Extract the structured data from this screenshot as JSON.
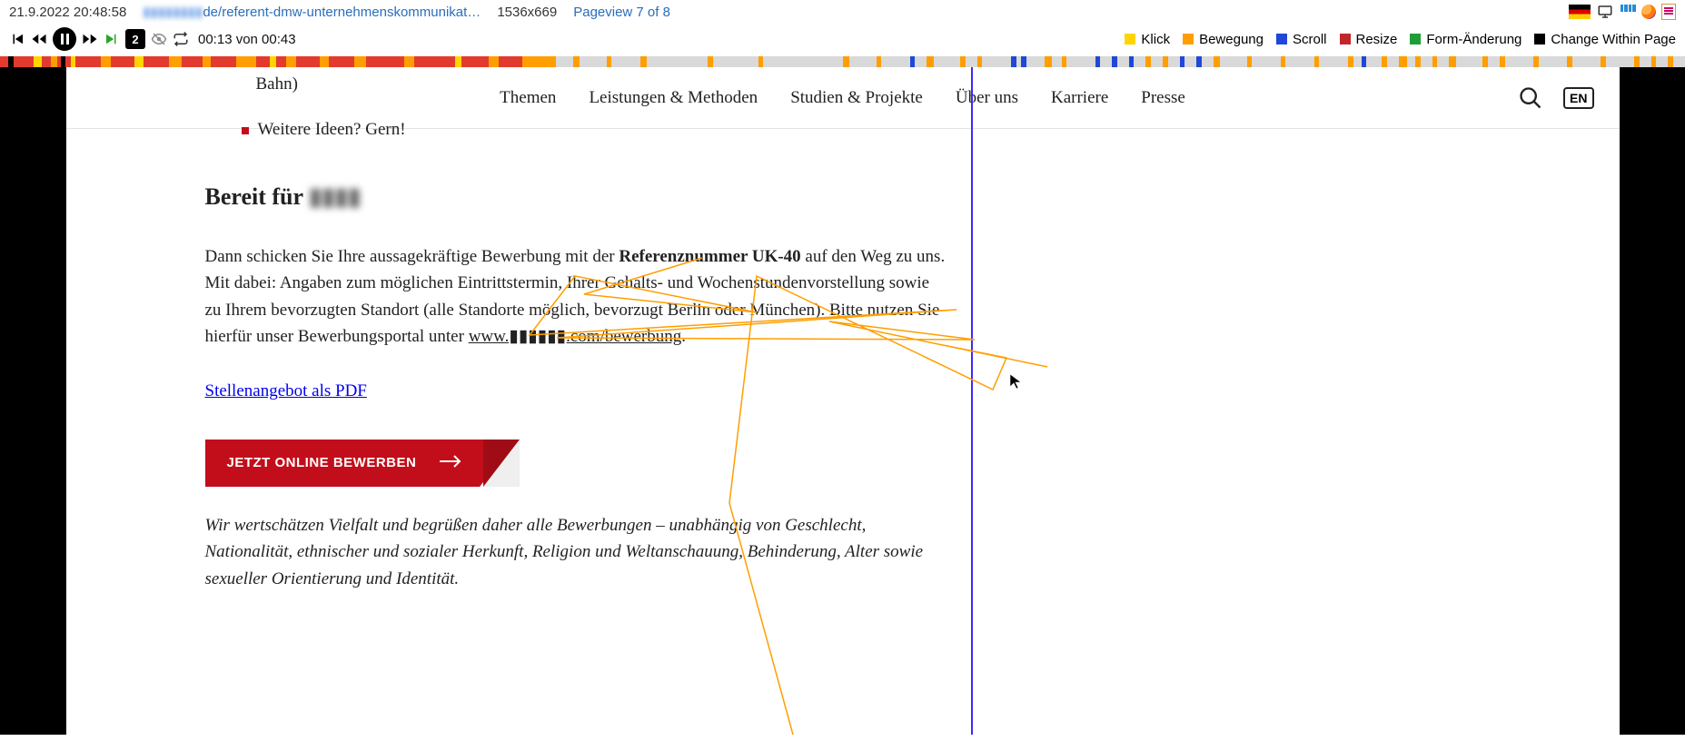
{
  "infobar": {
    "timestamp": "21.9.2022 20:48:58",
    "url_redacted_prefix": "▮▮▮▮▮▮▮▮",
    "url_visible": "de/referent-dmw-unternehmenskommunikat…",
    "dimensions": "1536x669",
    "pageview": "Pageview 7 of 8"
  },
  "playback": {
    "speed": "2",
    "time": "00:13 von 00:43"
  },
  "legend": {
    "klick": "Klick",
    "bewegung": "Bewegung",
    "scroll": "Scroll",
    "resize": "Resize",
    "form": "Form-Änderung",
    "change": "Change Within Page"
  },
  "nav": {
    "items": [
      "Themen",
      "Leistungen & Methoden",
      "Studien & Projekte",
      "Über uns",
      "Karriere",
      "Presse"
    ],
    "lang": "EN"
  },
  "content": {
    "prev_line_tail": "Bahn)",
    "bullet": "Weitere Ideen? Gern!",
    "heading_prefix": "Bereit für",
    "heading_blurred": "▮▮▮▮",
    "para_1": "Dann schicken Sie Ihre aussagekräftige Bewerbung mit der ",
    "ref_bold": "Referenznummer UK-40",
    "para_2": " auf den Weg zu uns. Mit dabei: Angaben zum möglichen Eintrittstermin, Ihrer Gehalts- und Wochenstundenvorstellung sowie zu Ihrem bevorzugten Standort (alle Standorte möglich, bevorzugt Berlin oder München). Bitte nutzen Sie hierfür unser Bewerbungsportal unter ",
    "link_text": "www.▮▮▮▮▮▮.com/bewerbung",
    "period": ".",
    "pdf": "Stellenangebot als PDF",
    "cta": "JETZT ONLINE BEWERBEN",
    "diversity": "Wir wertschätzen Vielfalt und begrüßen daher alle Bewerbungen – unabhängig von Geschlecht, Nationalität, ethnischer und sozialer Herkunft, Religion und Weltanschauung, Behinderung, Alter sowie sexueller Orientierung und Identität."
  }
}
